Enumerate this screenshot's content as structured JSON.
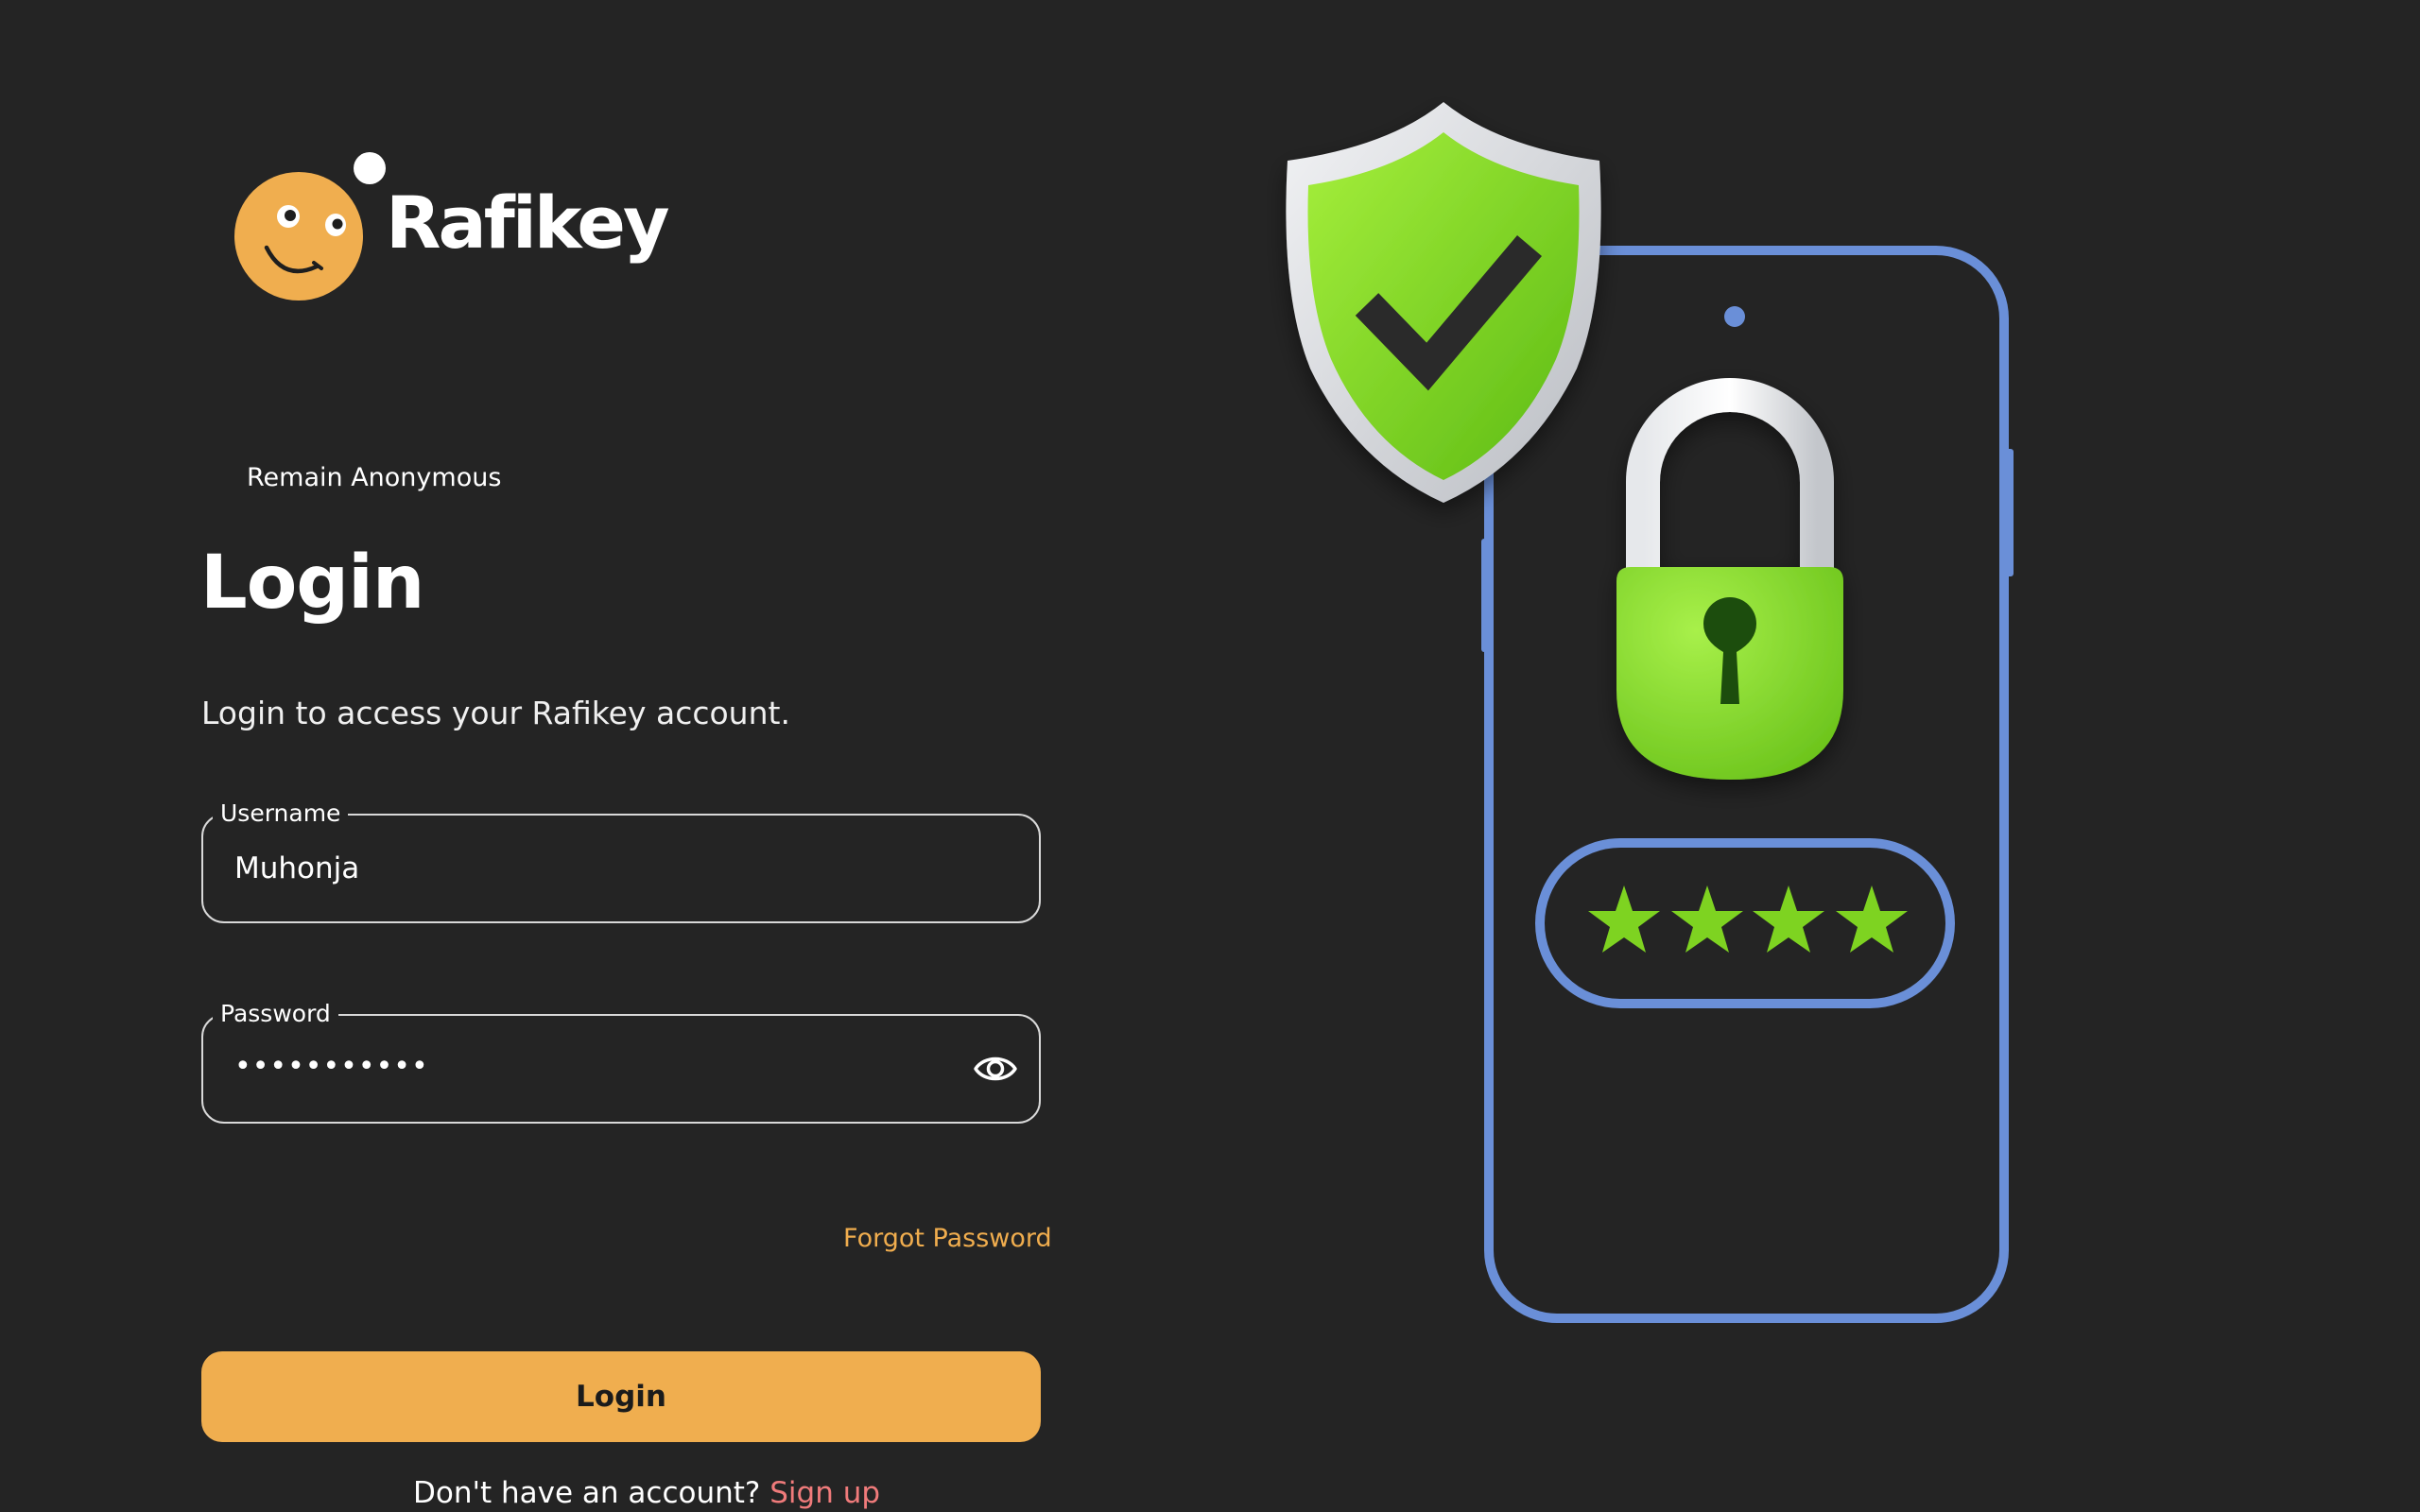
{
  "brand": {
    "name": "Rafikey",
    "accent_color": "#f0ae4f",
    "logo_icon": "smiley-face-icon"
  },
  "anonymous_toggle": {
    "label": "Remain Anonymous"
  },
  "login_form": {
    "title": "Login",
    "subtitle": "Login to access your Rafikey account.",
    "username": {
      "label": "Username",
      "value": "Muhonja"
    },
    "password": {
      "label": "Password",
      "value": "•••••••••••",
      "toggle_icon": "eye-icon"
    },
    "forgot_password": "Forgot Password",
    "submit_label": "Login",
    "signup_prompt": "Don't have an account?",
    "signup_link": "Sign up",
    "signup_link_color": "#f07b7b"
  },
  "illustration": {
    "icons": [
      "shield-check-icon",
      "phone-icon",
      "padlock-icon",
      "password-stars-icon"
    ],
    "star_count": 4,
    "colors": {
      "phone_outline": "#6a8fd8",
      "green": "#7ed321",
      "shield_border": "#d7d9dd"
    }
  }
}
